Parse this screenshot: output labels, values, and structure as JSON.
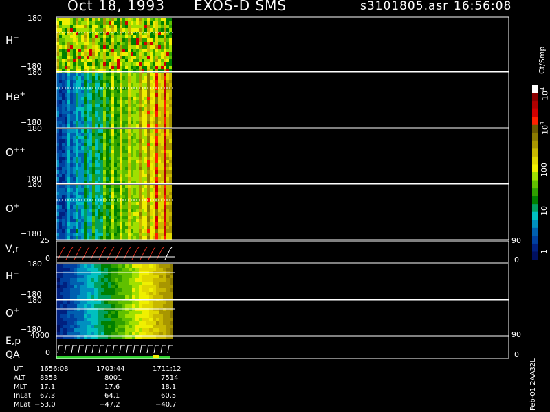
{
  "header": {
    "date": "Oct 18, 1993",
    "instrument": "EXOS-D SMS",
    "file": "s3101805.asr",
    "time": "16:56:08"
  },
  "panels": [
    {
      "label": "H",
      "sup": "+",
      "ymax": "180",
      "ymin": "−180"
    },
    {
      "label": "He",
      "sup": "+",
      "ymax": "180",
      "ymin": "−180"
    },
    {
      "label": "O",
      "sup": "++",
      "ymax": "180",
      "ymin": "−180"
    },
    {
      "label": "O",
      "sup": "+",
      "ymax": "180",
      "ymin": "−180"
    }
  ],
  "vr_panel": {
    "label": "V,r",
    "ymax": "25",
    "ymin": "0",
    "rmax": "90",
    "rmin": "0"
  },
  "lower_panels": [
    {
      "label": "H",
      "sup": "+",
      "ymax": "180",
      "ymin": "−180"
    },
    {
      "label": "O",
      "sup": "+",
      "ymax": "180",
      "ymin": "−180"
    }
  ],
  "ep_panel": {
    "label": "E,p",
    "ymax": "4000",
    "ymin": "0",
    "rmax": "90",
    "rmin": "0"
  },
  "qa_label": "QA",
  "colorbar": {
    "unit": "Ct/Smp",
    "ticks": [
      "10",
      "10",
      "100",
      "10",
      "1"
    ],
    "tick_exps": [
      "4",
      "3",
      "",
      "",
      ""
    ],
    "colors": [
      "#ffffff",
      "#8b0000",
      "#b00000",
      "#d00000",
      "#ff2000",
      "#6b5a00",
      "#8b7a00",
      "#a89600",
      "#c8b800",
      "#e0d800",
      "#f0f000",
      "#a0e000",
      "#60c000",
      "#30a000",
      "#008000",
      "#00a060",
      "#00c0c0",
      "#0090c0",
      "#0060b0",
      "#0040a0",
      "#002080",
      "#001060"
    ]
  },
  "bottom_table": {
    "rows": [
      {
        "name": "UT",
        "values": [
          "1656:08",
          "1703:44",
          "1711:12"
        ]
      },
      {
        "name": "ALT",
        "values": [
          "8353",
          "8001",
          "7514"
        ]
      },
      {
        "name": "MLT",
        "values": [
          "17.1",
          "17.6",
          "18.1"
        ]
      },
      {
        "name": "InLat",
        "values": [
          "67.3",
          "64.1",
          "60.5"
        ]
      },
      {
        "name": "MLat",
        "values": [
          "−53.0",
          "−47.2",
          "−40.7"
        ]
      }
    ]
  },
  "footer_note": "Feb-01  2AA32L",
  "chart_data": {
    "type": "heatmap",
    "title": "Oct 18, 1993   EXOS-D SMS   s3101805.asr  16:56:08",
    "x_ticks": [
      "1656:08",
      "1703:44",
      "1711:12"
    ],
    "panels": [
      {
        "name": "H+",
        "ylim": [
          -180,
          180
        ]
      },
      {
        "name": "He+",
        "ylim": [
          -180,
          180
        ]
      },
      {
        "name": "O++",
        "ylim": [
          -180,
          180
        ]
      },
      {
        "name": "O+",
        "ylim": [
          -180,
          180
        ]
      },
      {
        "name": "V,r",
        "ylim": [
          0,
          25
        ],
        "y2lim": [
          0,
          90
        ]
      },
      {
        "name": "H+",
        "ylim": [
          -180,
          180
        ]
      },
      {
        "name": "O+",
        "ylim": [
          -180,
          180
        ]
      },
      {
        "name": "E,p",
        "ylim": [
          0,
          4000
        ],
        "y2lim": [
          0,
          90
        ]
      }
    ],
    "colorbar": {
      "label": "Ct/Smp",
      "scale": "log",
      "range": [
        1,
        10000
      ]
    }
  }
}
